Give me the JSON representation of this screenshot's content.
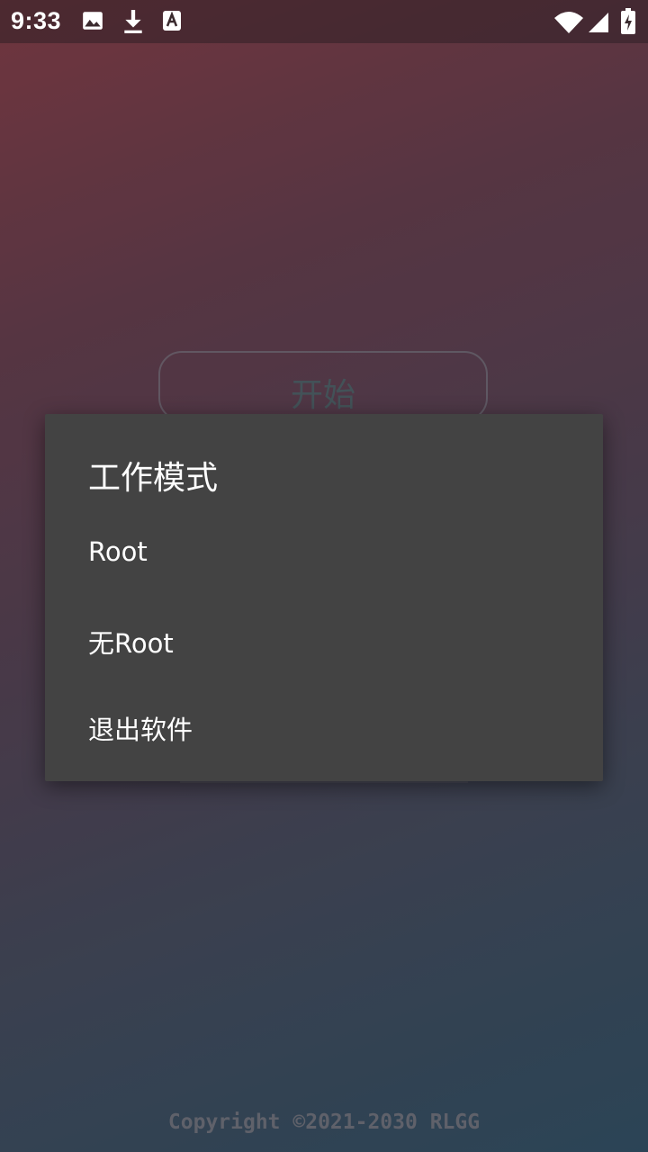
{
  "status_bar": {
    "time": "9:33",
    "left_icons": [
      "image-icon",
      "download-icon",
      "a-notification-icon"
    ],
    "right_icons": [
      "wifi-icon",
      "signal-icon",
      "battery-charging-icon"
    ]
  },
  "main": {
    "start_button_label": "开始",
    "copyright": "Copyright ©2021-2030 RLGG"
  },
  "dialog": {
    "title": "工作模式",
    "options": [
      {
        "label": "Root"
      },
      {
        "label": "无Root"
      },
      {
        "label": "退出软件"
      }
    ]
  },
  "colors": {
    "dialog_bg": "#434343",
    "text": "#ffffff",
    "gradient_top": "#7a3a44",
    "gradient_bottom": "#2f4a5e"
  }
}
